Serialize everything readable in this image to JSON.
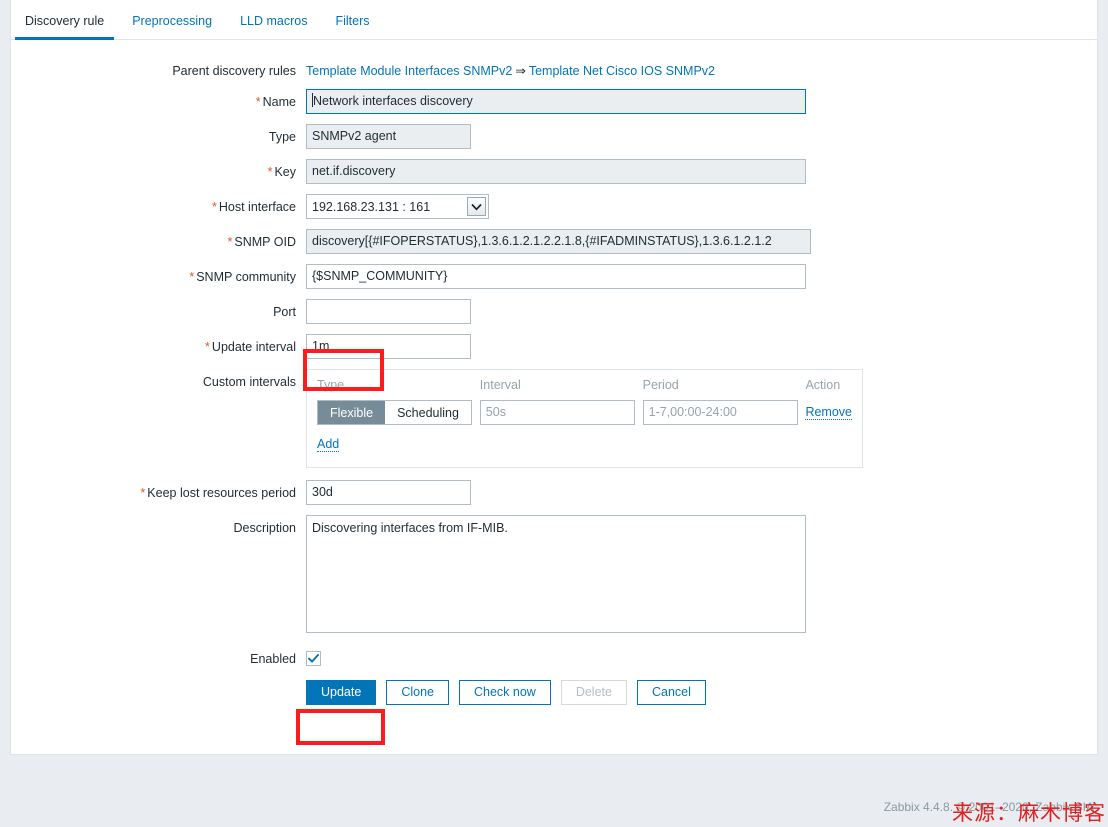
{
  "tabs": [
    {
      "label": "Discovery rule",
      "active": true
    },
    {
      "label": "Preprocessing",
      "active": false
    },
    {
      "label": "LLD macros",
      "active": false
    },
    {
      "label": "Filters",
      "active": false
    }
  ],
  "form": {
    "parent_rules": {
      "label": "Parent discovery rules",
      "link1": "Template Module Interfaces SNMPv2",
      "separator": "⇒",
      "link2": "Template Net Cisco IOS SNMPv2"
    },
    "name": {
      "label": "Name",
      "required": true,
      "value": "Network interfaces discovery"
    },
    "type": {
      "label": "Type",
      "required": false,
      "value": "SNMPv2 agent"
    },
    "key": {
      "label": "Key",
      "required": true,
      "value": "net.if.discovery"
    },
    "host_interface": {
      "label": "Host interface",
      "required": true,
      "value": "192.168.23.131 : 161",
      "icon": "chevron-down-icon"
    },
    "snmp_oid": {
      "label": "SNMP OID",
      "required": true,
      "value": "discovery[{#IFOPERSTATUS},1.3.6.1.2.1.2.2.1.8,{#IFADMINSTATUS},1.3.6.1.2.1.2"
    },
    "snmp_community": {
      "label": "SNMP community",
      "required": true,
      "value": "{$SNMP_COMMUNITY}"
    },
    "port": {
      "label": "Port",
      "required": false,
      "value": ""
    },
    "update_interval": {
      "label": "Update interval",
      "required": true,
      "value": "1m"
    },
    "custom_intervals": {
      "label": "Custom intervals",
      "headers": {
        "type": "Type",
        "interval": "Interval",
        "period": "Period",
        "action": "Action"
      },
      "rows": [
        {
          "type_flexible": "Flexible",
          "type_scheduling": "Scheduling",
          "selected_type": "Flexible",
          "interval_value": "",
          "interval_placeholder": "50s",
          "period_value": "",
          "period_placeholder": "1-7,00:00-24:00",
          "action": "Remove"
        }
      ],
      "add_label": "Add"
    },
    "keep_lost": {
      "label": "Keep lost resources period",
      "required": true,
      "value": "30d"
    },
    "description": {
      "label": "Description",
      "required": false,
      "value": "Discovering interfaces from IF-MIB."
    },
    "enabled": {
      "label": "Enabled",
      "checked": true,
      "icon": "check-icon"
    }
  },
  "buttons": [
    {
      "label": "Update",
      "style": "primary",
      "disabled": false
    },
    {
      "label": "Clone",
      "style": "secondary",
      "disabled": false
    },
    {
      "label": "Check now",
      "style": "secondary",
      "disabled": false
    },
    {
      "label": "Delete",
      "style": "secondary",
      "disabled": true
    },
    {
      "label": "Cancel",
      "style": "secondary",
      "disabled": false
    }
  ],
  "footer": {
    "text": "Zabbix 4.4.8. © 2001–2020, Zabbix SIA"
  },
  "annotations": {
    "watermark": "来源：麻木博客",
    "highlight_color": "#fb1c1c"
  }
}
